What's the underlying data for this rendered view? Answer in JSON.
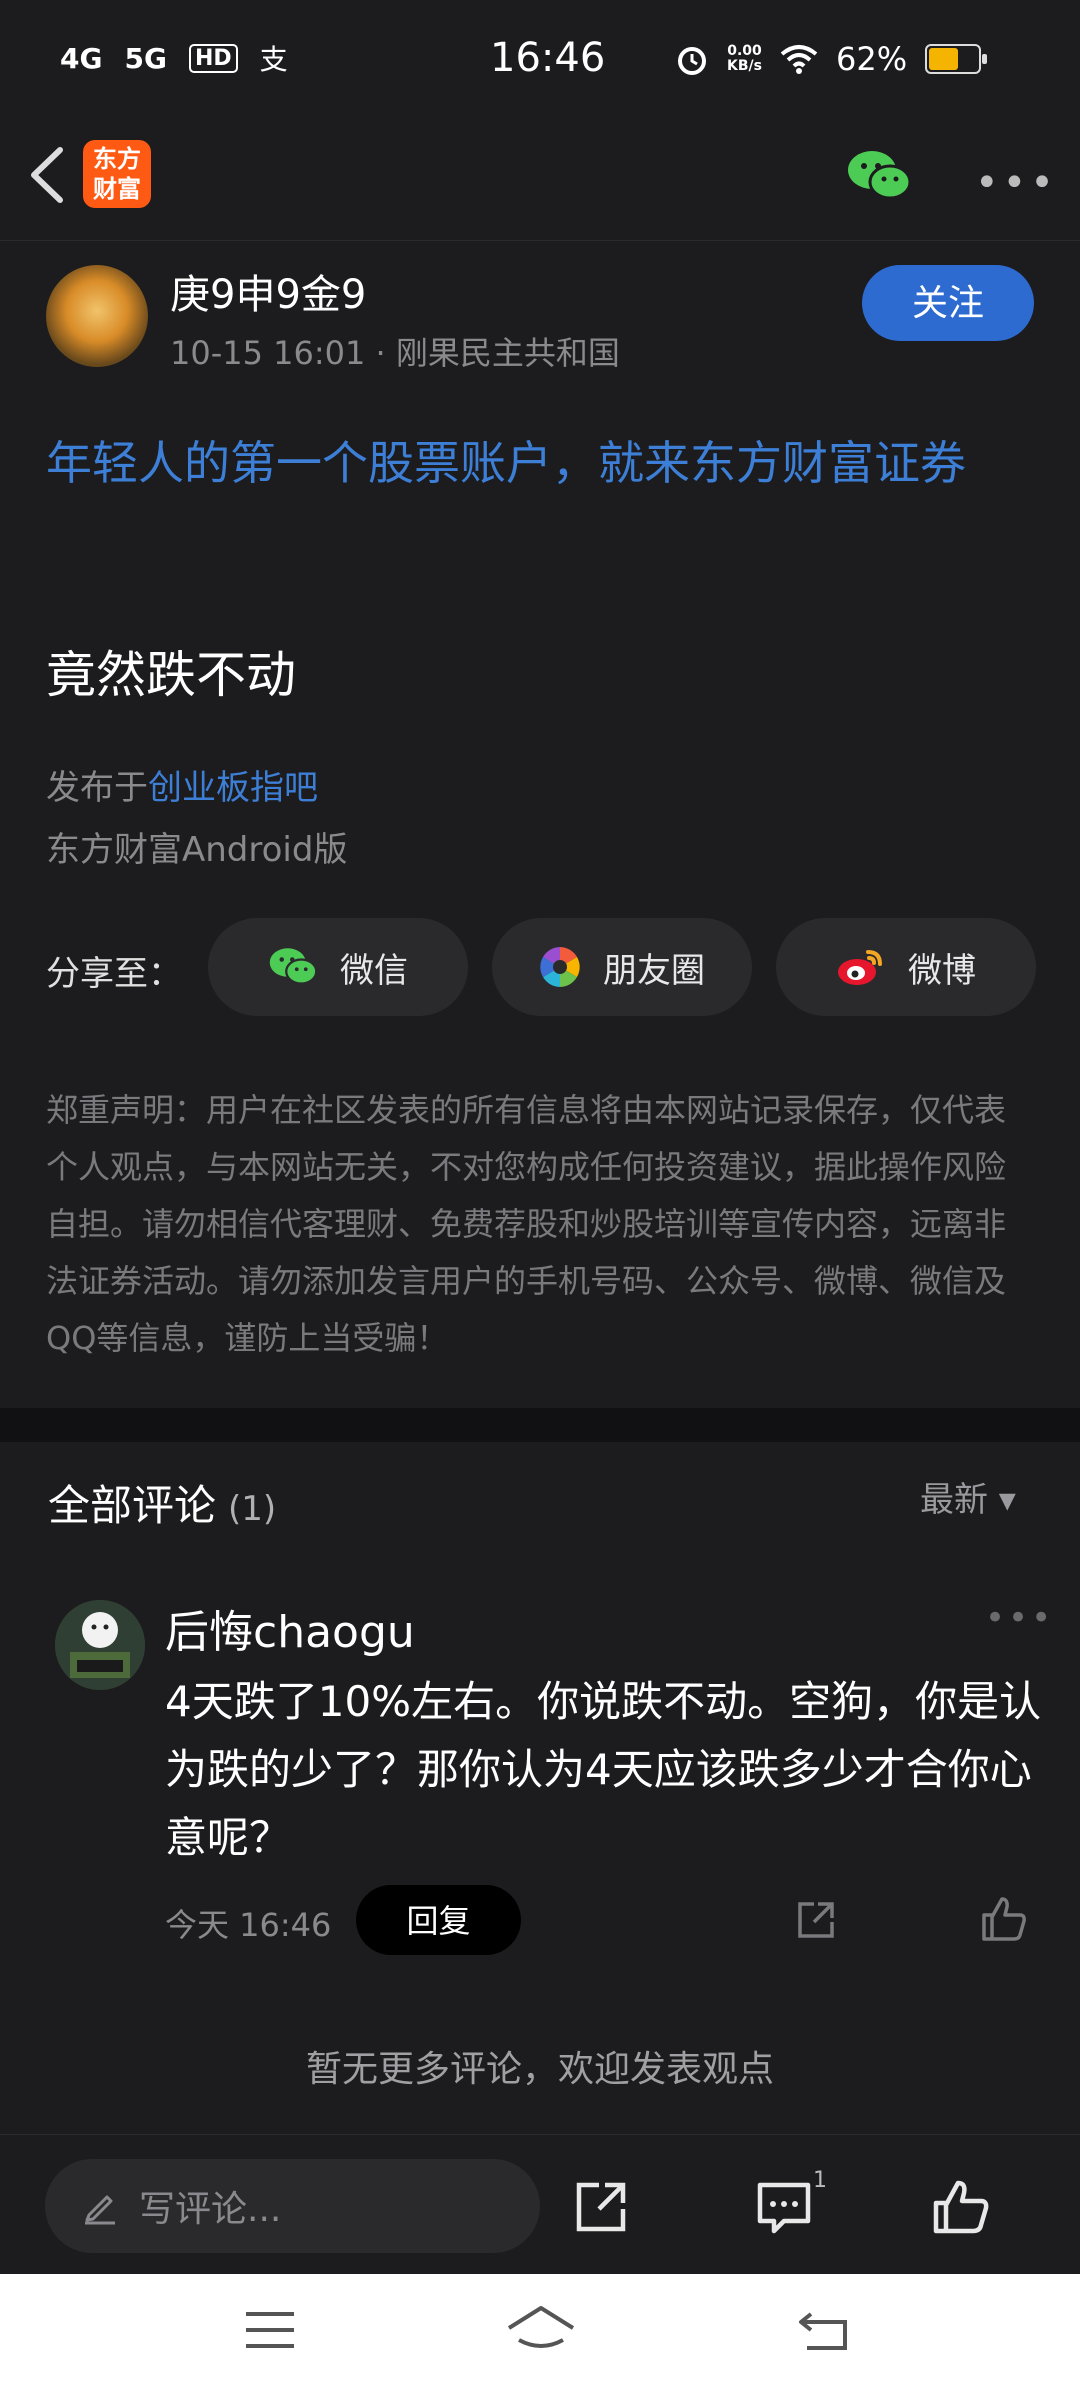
{
  "status_bar": {
    "signal_1": "4G",
    "signal_2": "5G",
    "hd": "HD",
    "pay_icon": "支",
    "time": "16:46",
    "net_speed_value": "0.00",
    "net_speed_unit": "KB/s",
    "battery": "62%",
    "battery_level": 0.62
  },
  "header": {
    "logo_line1": "东方",
    "logo_line2": "财富"
  },
  "post": {
    "author": "庚9申9金9",
    "meta": "10-15 16:01 · 刚果民主共和国",
    "follow_label": "关注",
    "ad_link": "年轻人的第一个股票账户，就来东方财富证券",
    "title": "竟然跌不动",
    "board_prefix": "发布于",
    "board_name": "创业板指吧",
    "client": "东方财富Android版"
  },
  "share": {
    "label": "分享至：",
    "options": [
      {
        "label": "微信",
        "icon": "wechat-icon"
      },
      {
        "label": "朋友圈",
        "icon": "moments-icon"
      },
      {
        "label": "微博",
        "icon": "weibo-icon"
      }
    ]
  },
  "disclaimer": "郑重声明：用户在社区发表的所有信息将由本网站记录保存，仅代表个人观点，与本网站无关，不对您构成任何投资建议，据此操作风险自担。请勿相信代客理财、免费荐股和炒股培训等宣传内容，远离非法证券活动。请勿添加发言用户的手机号码、公众号、微博、微信及QQ等信息，谨防上当受骗！",
  "comments": {
    "title": "全部评论",
    "count": "(1)",
    "sort_label": "最新 ▾",
    "items": [
      {
        "user": "后悔chaogu",
        "text": "4天跌了10%左右。你说跌不动。空狗，你是认为跌的少了？那你认为4天应该跌多少才合你心意呢？",
        "time": "今天 16:46",
        "reply_label": "回复"
      }
    ],
    "no_more": "暂无更多评论，欢迎发表观点"
  },
  "bottom_bar": {
    "placeholder": "写评论...",
    "comment_badge": "1"
  }
}
